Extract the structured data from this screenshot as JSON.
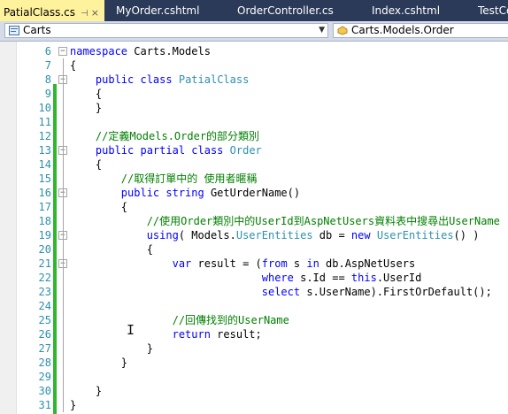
{
  "tabs": [
    {
      "label": "PatialClass.cs",
      "active": true
    },
    {
      "label": "MyOrder.cshtml",
      "active": false
    },
    {
      "label": "OrderController.cs",
      "active": false
    },
    {
      "label": "Index.cshtml",
      "active": false
    },
    {
      "label": "TestCont",
      "active": false
    }
  ],
  "tab_pin": "⊣",
  "tab_close": "×",
  "nav": {
    "project": "Carts",
    "type": "Carts.Models.Order"
  },
  "colors": {
    "keyword": "#0000ff",
    "type": "#2b91af",
    "comment": "#008000",
    "line_number": "#2b91af",
    "change_bar": "#2fb82f",
    "active_tab": "#fff29d",
    "tab_bar": "#2b3a58"
  },
  "lines": [
    {
      "n": "6",
      "parts": [
        {
          "t": "kw",
          "v": "namespace"
        },
        {
          "t": "tx",
          "v": " Carts.Models"
        }
      ]
    },
    {
      "n": "7",
      "parts": [
        {
          "t": "tx",
          "v": "{"
        }
      ]
    },
    {
      "n": "8",
      "parts": [
        {
          "t": "tx",
          "v": "    "
        },
        {
          "t": "kw",
          "v": "public class"
        },
        {
          "t": "tx",
          "v": " "
        },
        {
          "t": "ty",
          "v": "PatialClass"
        }
      ]
    },
    {
      "n": "9",
      "parts": [
        {
          "t": "tx",
          "v": "    {"
        }
      ]
    },
    {
      "n": "10",
      "parts": [
        {
          "t": "tx",
          "v": "    }"
        }
      ]
    },
    {
      "n": "11",
      "parts": []
    },
    {
      "n": "12",
      "parts": [
        {
          "t": "cm",
          "v": "    //定義Models.Order的部分類別"
        }
      ]
    },
    {
      "n": "13",
      "parts": [
        {
          "t": "tx",
          "v": "    "
        },
        {
          "t": "kw",
          "v": "public partial class"
        },
        {
          "t": "tx",
          "v": " "
        },
        {
          "t": "ty",
          "v": "Order"
        }
      ]
    },
    {
      "n": "14",
      "parts": [
        {
          "t": "tx",
          "v": "    {"
        }
      ]
    },
    {
      "n": "15",
      "parts": [
        {
          "t": "cm",
          "v": "        //取得訂單中的 使用者暱稱"
        }
      ]
    },
    {
      "n": "16",
      "parts": [
        {
          "t": "tx",
          "v": "        "
        },
        {
          "t": "kw",
          "v": "public string"
        },
        {
          "t": "tx",
          "v": " GetUrderName()"
        }
      ]
    },
    {
      "n": "17",
      "parts": [
        {
          "t": "tx",
          "v": "        {"
        }
      ]
    },
    {
      "n": "18",
      "parts": [
        {
          "t": "cm",
          "v": "            //使用Order類別中的UserId到AspNetUsers資料表中搜尋出UserName"
        }
      ]
    },
    {
      "n": "19",
      "parts": [
        {
          "t": "tx",
          "v": "            "
        },
        {
          "t": "kw",
          "v": "using"
        },
        {
          "t": "tx",
          "v": "( Models."
        },
        {
          "t": "ty",
          "v": "UserEntities"
        },
        {
          "t": "tx",
          "v": " db = "
        },
        {
          "t": "kw",
          "v": "new"
        },
        {
          "t": "tx",
          "v": " "
        },
        {
          "t": "ty",
          "v": "UserEntities"
        },
        {
          "t": "tx",
          "v": "() )"
        }
      ]
    },
    {
      "n": "20",
      "parts": [
        {
          "t": "tx",
          "v": "            {"
        }
      ]
    },
    {
      "n": "21",
      "parts": [
        {
          "t": "tx",
          "v": "                "
        },
        {
          "t": "kw",
          "v": "var"
        },
        {
          "t": "tx",
          "v": " result = ("
        },
        {
          "t": "kw",
          "v": "from"
        },
        {
          "t": "tx",
          "v": " s "
        },
        {
          "t": "kw",
          "v": "in"
        },
        {
          "t": "tx",
          "v": " db.AspNetUsers"
        }
      ]
    },
    {
      "n": "22",
      "parts": [
        {
          "t": "tx",
          "v": "                              "
        },
        {
          "t": "kw",
          "v": "where"
        },
        {
          "t": "tx",
          "v": " s.Id == "
        },
        {
          "t": "kw",
          "v": "this"
        },
        {
          "t": "tx",
          "v": ".UserId"
        }
      ]
    },
    {
      "n": "23",
      "parts": [
        {
          "t": "tx",
          "v": "                              "
        },
        {
          "t": "kw",
          "v": "select"
        },
        {
          "t": "tx",
          "v": " s.UserName).FirstOrDefault();"
        }
      ]
    },
    {
      "n": "24",
      "parts": []
    },
    {
      "n": "25",
      "parts": [
        {
          "t": "cm",
          "v": "                //回傳找到的UserName"
        }
      ]
    },
    {
      "n": "26",
      "parts": [
        {
          "t": "tx",
          "v": "                "
        },
        {
          "t": "kw",
          "v": "return"
        },
        {
          "t": "tx",
          "v": " result;"
        }
      ]
    },
    {
      "n": "27",
      "parts": [
        {
          "t": "tx",
          "v": "            }"
        }
      ]
    },
    {
      "n": "28",
      "parts": [
        {
          "t": "tx",
          "v": "        }"
        }
      ]
    },
    {
      "n": "29",
      "parts": []
    },
    {
      "n": "30",
      "parts": [
        {
          "t": "tx",
          "v": "    }"
        }
      ]
    },
    {
      "n": "31",
      "parts": [
        {
          "t": "tx",
          "v": "}"
        }
      ]
    }
  ]
}
